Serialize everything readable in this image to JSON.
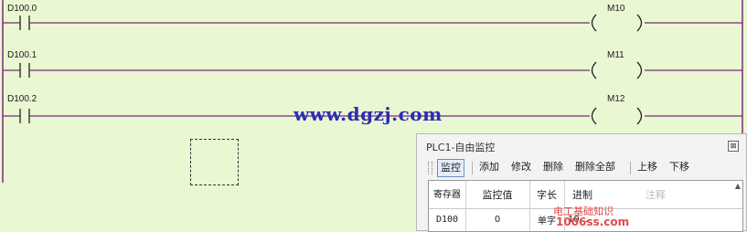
{
  "rungs": [
    {
      "contact": "D100.0",
      "coil": "M10"
    },
    {
      "contact": "D100.1",
      "coil": "M11"
    },
    {
      "contact": "D100.2",
      "coil": "M12"
    }
  ],
  "watermark": "www.dgzj.com",
  "panel": {
    "title": "PLC1-自由监控",
    "close_glyph": "⊠",
    "toolbar": [
      "监控",
      "添加",
      "修改",
      "删除",
      "删除全部",
      "上移",
      "下移"
    ],
    "columns": [
      "寄存器",
      "监控值",
      "字长",
      "进制",
      "注释"
    ],
    "rows": [
      {
        "register": "D100",
        "value": "0",
        "word_length": "单字",
        "radix": "10..."
      }
    ],
    "scroll_up_glyph": "▲"
  },
  "corner_watermark": {
    "line1": "电工基础知识",
    "line2": "1006ss.com"
  },
  "colors": {
    "background": "#eaf7d3",
    "rung_line": "#7a2a7a",
    "watermark": "#2d2db3"
  }
}
